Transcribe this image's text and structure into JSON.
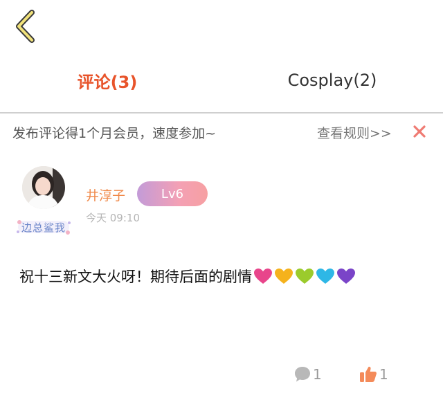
{
  "nav": {
    "back_icon": "chevron-left-icon"
  },
  "tabs": [
    {
      "label": "评论(3)",
      "active": true
    },
    {
      "label": "Cosplay(2)",
      "active": false
    }
  ],
  "notice": {
    "text": "发布评论得1个月会员，速度参加~",
    "rules_link": "查看规则>>",
    "close_icon": "close-icon"
  },
  "comment": {
    "username": "井淳子",
    "level": "Lv6",
    "timestamp": "今天 09:10",
    "avatar_frame_text": "边总鲨我",
    "text": "祝十三新文大火呀！期待后面的剧情",
    "hearts": [
      {
        "name": "pink-heart-icon",
        "color": "#e8458b"
      },
      {
        "name": "yellow-heart-icon",
        "color": "#f5b21c"
      },
      {
        "name": "green-heart-icon",
        "color": "#9bcb2c"
      },
      {
        "name": "blue-heart-icon",
        "color": "#2eb7e6"
      },
      {
        "name": "purple-heart-icon",
        "color": "#7a44c8"
      }
    ],
    "reply_count": "1",
    "like_count": "1"
  },
  "colors": {
    "accent": "#e8542b",
    "username": "#f08a4b",
    "close": "#ef7b73",
    "like": "#f48b5a",
    "reply": "#b8b8b8"
  }
}
